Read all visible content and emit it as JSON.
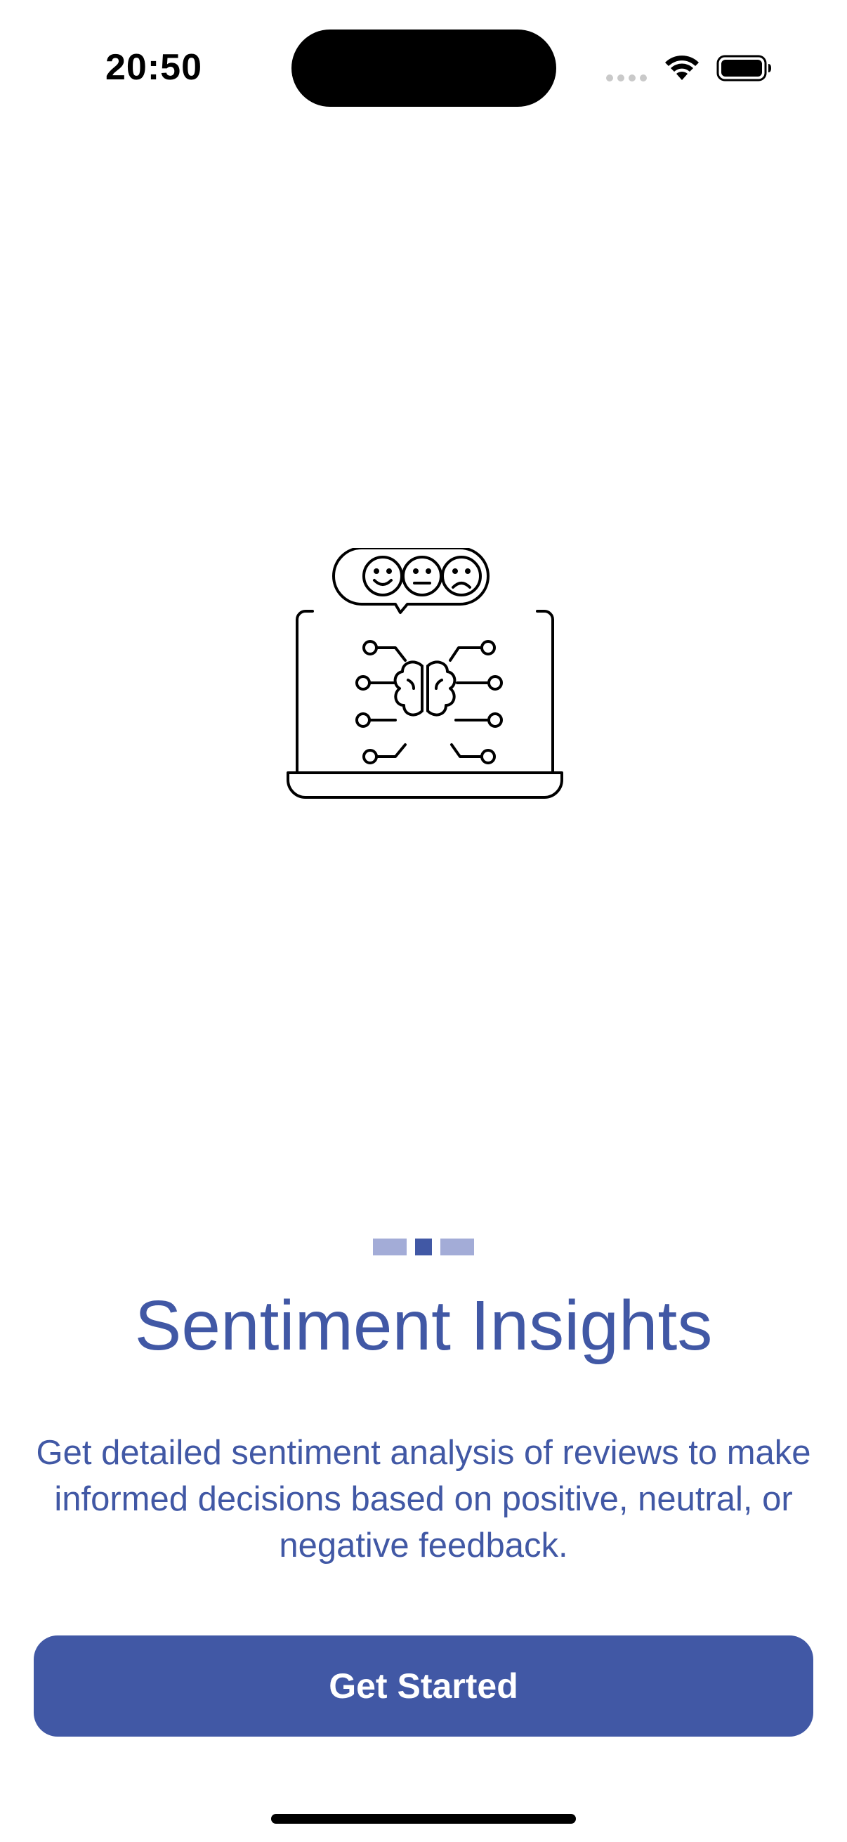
{
  "status_bar": {
    "time": "20:50",
    "wifi_icon": "wifi-icon",
    "battery_icon": "battery-icon"
  },
  "illustration": {
    "icon": "laptop-brain-sentiment-icon"
  },
  "page_indicator": {
    "total": 3,
    "active_index": 1
  },
  "onboarding": {
    "title": "Sentiment Insights",
    "description": "Get detailed sentiment analysis of reviews to make informed decisions based on positive, neutral, or negative feedback.",
    "cta_label": "Get Started"
  },
  "colors": {
    "accent": "#4158a5",
    "indicator_inactive": "#a3acd7",
    "background": "#ffffff"
  }
}
